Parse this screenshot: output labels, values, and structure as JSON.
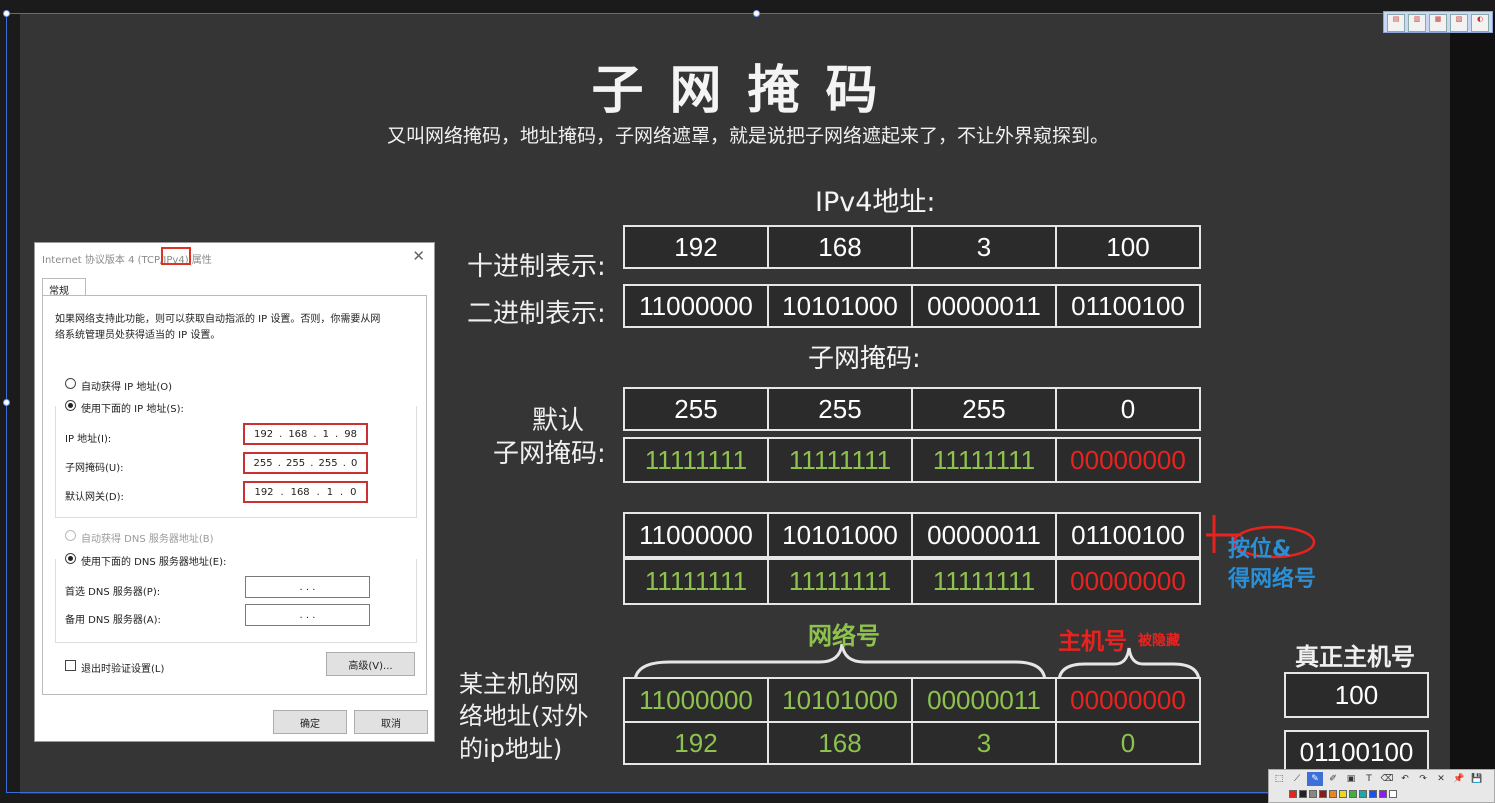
{
  "slide": {
    "title": "子网掩码",
    "subtitle": "又叫网络掩码，地址掩码，子网络遮罩，就是说把子网络遮起来了，不让外界窥探到。",
    "ipv4_heading": "IPv4地址:",
    "decimal_label": "十进制表示:",
    "binary_label": "二进制表示:",
    "mask_heading": "子网掩码:",
    "default_mask_label_1": "默认",
    "default_mask_label_2": "子网掩码:",
    "ip_decimal": [
      "192",
      "168",
      "3",
      "100"
    ],
    "ip_binary": [
      "11000000",
      "10101000",
      "00000011",
      "01100100"
    ],
    "mask_decimal": [
      "255",
      "255",
      "255",
      "0"
    ],
    "mask_binary": [
      "11111111",
      "11111111",
      "11111111",
      "00000000"
    ],
    "and_ip_binary": [
      "11000000",
      "10101000",
      "00000011",
      "01100100"
    ],
    "and_mask_binary": [
      "11111111",
      "11111111",
      "11111111",
      "00000000"
    ],
    "annotation_and_1": "按位&",
    "annotation_and_2": "得网络号",
    "network_brace_label": "网络号",
    "host_brace_label": "主机号",
    "host_hidden_label": "被隐藏",
    "host_network_label_1": "某主机的网",
    "host_network_label_2": "络地址(对外",
    "host_network_label_3": "的ip地址)",
    "network_binary": [
      "11000000",
      "10101000",
      "00000011",
      "00000000"
    ],
    "network_decimal": [
      "192",
      "168",
      "3",
      "0"
    ],
    "real_host_label": "真正主机号",
    "real_host_decimal": "100",
    "real_host_binary": "01100100"
  },
  "dialog": {
    "title_prefix": "Internet 协议版本 4 (TCP/",
    "title_highlight": "IPv4",
    "title_suffix": ") 属性",
    "close": "✕",
    "tab_general": "常规",
    "description_1": "如果网络支持此功能，则可以获取自动指派的 IP 设置。否则，你需要从网",
    "description_2": "络系统管理员处获得适当的 IP 设置。",
    "radio_auto_ip": "自动获得 IP 地址(O)",
    "radio_manual_ip": "使用下面的 IP 地址(S):",
    "ip_address_label": "IP 地址(I):",
    "ip_address_value": [
      "192",
      ".",
      "168",
      ".",
      "1",
      ".",
      "98"
    ],
    "subnet_label": "子网掩码(U):",
    "subnet_value": [
      "255",
      ".",
      "255",
      ".",
      "255",
      ".",
      "0"
    ],
    "gateway_label": "默认网关(D):",
    "gateway_value": [
      "192",
      ".",
      "168",
      ".",
      "1",
      ".",
      "0"
    ],
    "radio_auto_dns": "自动获得 DNS 服务器地址(B)",
    "radio_manual_dns": "使用下面的 DNS 服务器地址(E):",
    "preferred_dns_label": "首选 DNS 服务器(P):",
    "alternate_dns_label": "备用 DNS 服务器(A):",
    "empty_ip": ".   .   .",
    "validate_checkbox": "退出时验证设置(L)",
    "advanced_button": "高级(V)...",
    "ok_button": "确定",
    "cancel_button": "取消"
  },
  "colors": {
    "green": "#8dc24d",
    "red": "#e8231f",
    "blue": "#2b8fd6",
    "slide_bg": "#353535"
  },
  "toolbar": {
    "tools": [
      "select-icon",
      "line-icon",
      "pen-icon",
      "highlighter-icon",
      "shape-icon",
      "text-icon",
      "eraser-icon",
      "undo-icon",
      "redo-icon",
      "close-icon",
      "pin-icon",
      "save-icon"
    ],
    "tool_glyphs": [
      "⬚",
      "⟋",
      "✎",
      "✐",
      "▣",
      "T",
      "⌫",
      "↶",
      "↷",
      "✕",
      "📌",
      "💾"
    ]
  }
}
